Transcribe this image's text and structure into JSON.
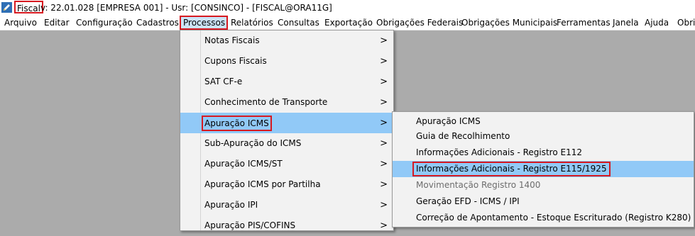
{
  "titlebar": {
    "app_name": "Fiscal",
    "title": "v: 22.01.028   [EMPRESA 001] - Usr: [CONSINCO] - [FISCAL@ORA11G]"
  },
  "menubar": [
    "Arquivo",
    "Editar",
    "Configuração",
    "Cadastros",
    "Processos",
    "Relatórios",
    "Consultas",
    "Exportação",
    "Obrigações Federais",
    "Obrigações Municipais",
    "Ferramentas",
    "Janela",
    "Ajuda",
    "Obri"
  ],
  "processos_menu": [
    "Notas Fiscais",
    "Cupons Fiscais",
    "SAT CF-e",
    "Conhecimento de Transporte",
    "Apuração ICMS",
    "Sub-Apuração do ICMS",
    "Apuração ICMS/ST",
    "Apuração ICMS por Partilha",
    "Apuração IPI",
    "Apuração PIS/COFINS"
  ],
  "apuracao_icms_menu": [
    "Apuração ICMS",
    "Guia de Recolhimento",
    "Informações Adicionais - Registro E112",
    "Informações Adicionais - Registro E115/1925",
    "Movimentação Registro 1400",
    "Geração EFD - ICMS / IPI",
    "Correção de Apontamento - Estoque Escriturado (Registro K280)"
  ],
  "submenu_arrow": ">",
  "colors": {
    "highlight": "#91c9f7",
    "annotation": "#d71920",
    "workspace": "#ababab"
  }
}
